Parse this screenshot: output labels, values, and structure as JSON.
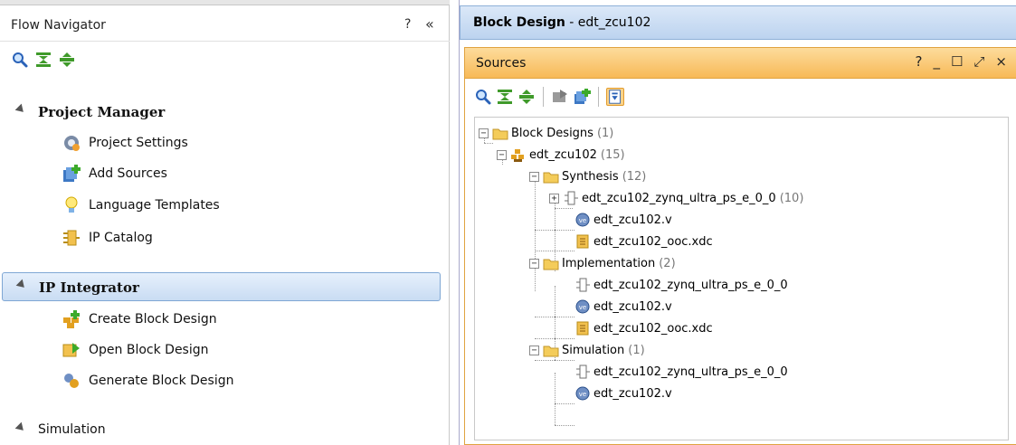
{
  "flow_navigator": {
    "title": "Flow Navigator",
    "help": "?",
    "collapse": "«",
    "toolbar": [
      "search-icon",
      "collapse-all-icon",
      "expand-all-icon"
    ],
    "sections": [
      {
        "title": "Project Manager",
        "items": [
          {
            "label": "Project Settings",
            "icon": "gear-icon"
          },
          {
            "label": "Add Sources",
            "icon": "add-sources-icon"
          },
          {
            "label": "Language Templates",
            "icon": "lightbulb-icon"
          },
          {
            "label": "IP Catalog",
            "icon": "ip-catalog-icon"
          }
        ]
      },
      {
        "title": "IP Integrator",
        "selected": true,
        "items": [
          {
            "label": "Create Block Design",
            "icon": "create-block-design-icon"
          },
          {
            "label": "Open Block Design",
            "icon": "open-block-design-icon"
          },
          {
            "label": "Generate Block Design",
            "icon": "generate-block-design-icon"
          }
        ]
      },
      {
        "title": "Simulation",
        "items": []
      }
    ]
  },
  "block_design": {
    "title_bold": "Block Design",
    "title_rest": " - edt_zcu102",
    "sources": {
      "title": "Sources",
      "window_buttons": [
        "?",
        "_",
        "☐",
        "⤢",
        "×"
      ],
      "toolbar": [
        "search-icon",
        "collapse-all-icon",
        "expand-all-icon",
        "open-folder-icon",
        "add-sources-icon",
        "hierarchy-update-icon"
      ],
      "tree": {
        "root": {
          "label": "Block Designs",
          "count": "(1)"
        },
        "design": {
          "label": "edt_zcu102",
          "count": "(15)"
        },
        "synthesis": {
          "label": "Synthesis",
          "count": "(12)"
        },
        "syn_items": [
          {
            "label": "edt_zcu102_zynq_ultra_ps_e_0_0",
            "count": "(10)",
            "icon": "ip-icon"
          },
          {
            "label": "edt_zcu102.v",
            "count": "",
            "icon": "verilog-icon"
          },
          {
            "label": "edt_zcu102_ooc.xdc",
            "count": "",
            "icon": "xdc-icon"
          }
        ],
        "implementation": {
          "label": "Implementation",
          "count": "(2)"
        },
        "impl_items": [
          {
            "label": "edt_zcu102_zynq_ultra_ps_e_0_0",
            "icon": "ip-icon"
          },
          {
            "label": "edt_zcu102.v",
            "icon": "verilog-icon"
          },
          {
            "label": "edt_zcu102_ooc.xdc",
            "icon": "xdc-icon"
          }
        ],
        "simulation": {
          "label": "Simulation",
          "count": "(1)"
        },
        "sim_items": [
          {
            "label": "edt_zcu102_zynq_ultra_ps_e_0_0",
            "icon": "ip-icon"
          },
          {
            "label": "edt_zcu102.v",
            "icon": "verilog-icon"
          }
        ]
      }
    }
  },
  "colors": {
    "selection_blue": "#c9dcf3",
    "sources_orange": "#f7b957",
    "header_blue": "#bcd3ef"
  }
}
